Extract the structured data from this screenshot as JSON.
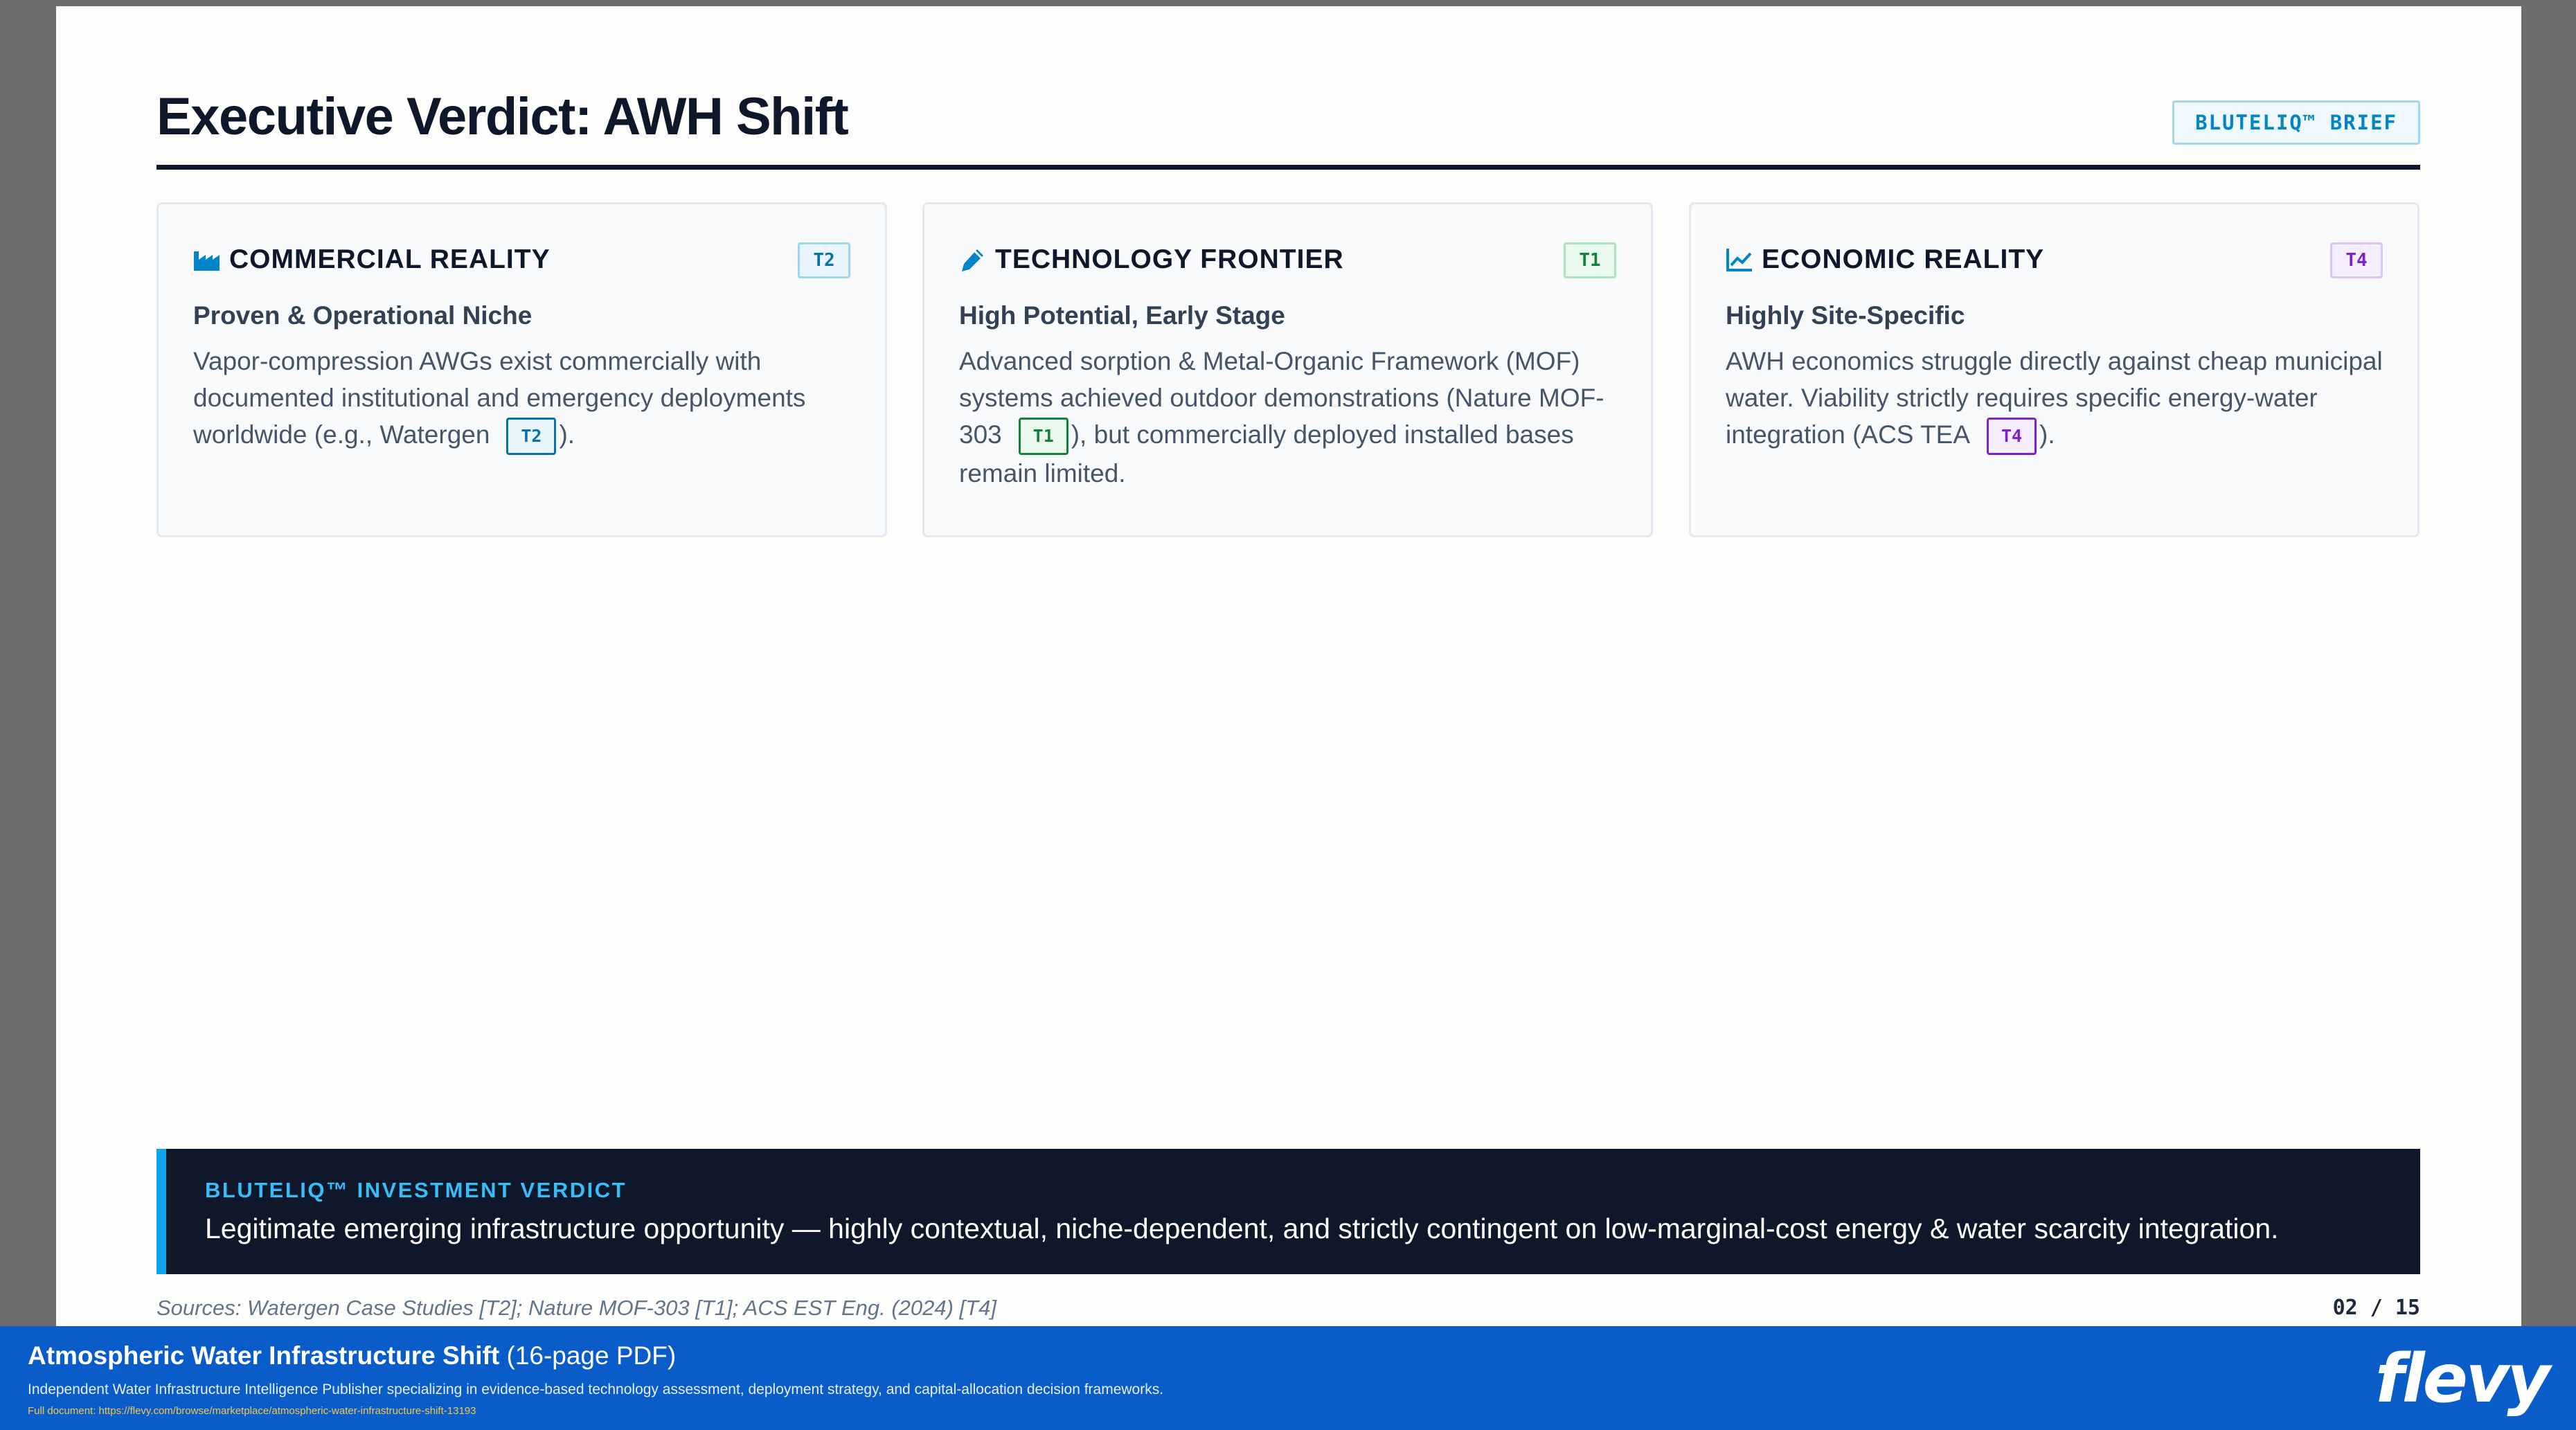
{
  "slide": {
    "title": "Executive Verdict: AWH Shift",
    "badge": "BLUTELIQ™ BRIEF",
    "cards": [
      {
        "icon": "factory-icon",
        "title": "COMMERCIAL REALITY",
        "tier": "T2",
        "subtitle": "Proven & Operational Niche",
        "body_before": "Vapor-compression AWGs exist commercially with documented institutional and emergency deployments worldwide (e.g., Watergen",
        "inline_tier": "T2",
        "body_after": ")."
      },
      {
        "icon": "pen-icon",
        "title": "TECHNOLOGY FRONTIER",
        "tier": "T1",
        "subtitle": "High Potential, Early Stage",
        "body_before": "Advanced sorption & Metal-Organic Framework (MOF) systems achieved outdoor demonstrations (Nature MOF-303",
        "inline_tier": "T1",
        "body_after": "), but commercially deployed installed bases remain limited."
      },
      {
        "icon": "line-chart-icon",
        "title": "ECONOMIC REALITY",
        "tier": "T4",
        "subtitle": "Highly Site-Specific",
        "body_before": "AWH economics struggle directly against cheap municipal water. Viability strictly requires specific energy-water integration (ACS TEA",
        "inline_tier": "T4",
        "body_after": ")."
      }
    ],
    "verdict": {
      "label": "BLUTELIQ™ INVESTMENT VERDICT",
      "text": "Legitimate emerging infrastructure opportunity — highly contextual, niche-dependent, and strictly contingent on low-marginal-cost energy & water scarcity integration."
    },
    "sources": "Sources: Watergen Case Studies [T2]; Nature MOF-303 [T1]; ACS EST Eng. (2024) [T4]",
    "page_number": "02 / 15"
  },
  "banner": {
    "title": "Atmospheric Water Infrastructure Shift",
    "pages": "(16-page PDF)",
    "description": "Independent Water Infrastructure Intelligence Publisher specializing in evidence-based technology assessment, deployment strategy, and capital-allocation decision frameworks.",
    "link": "Full document: https://flevy.com/browse/marketplace/atmospheric-water-infrastructure-shift-13193",
    "logo": "flevy"
  },
  "colors": {
    "accent": "#0ea5e9",
    "verdict_bg": "#0f172a",
    "banner_bg": "#0a5cc9",
    "tier_t1": "#15803d",
    "tier_t2": "#0b72a8",
    "tier_t4": "#7e22ce"
  }
}
